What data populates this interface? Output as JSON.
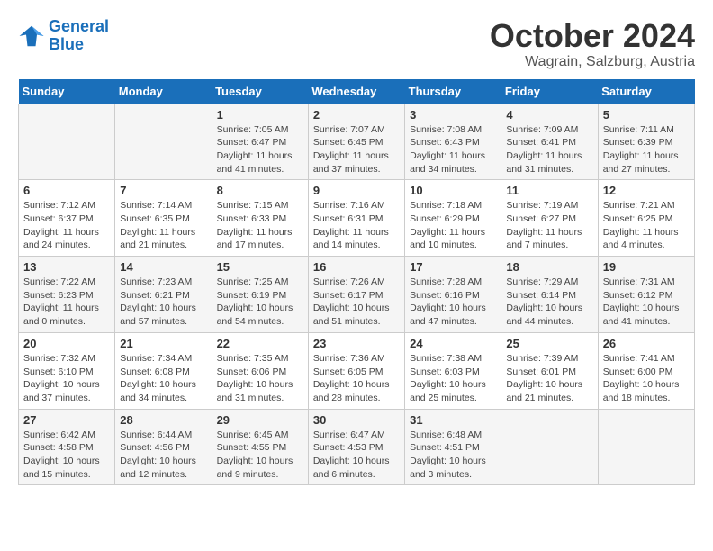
{
  "logo": {
    "line1": "General",
    "line2": "Blue"
  },
  "title": "October 2024",
  "location": "Wagrain, Salzburg, Austria",
  "days_of_week": [
    "Sunday",
    "Monday",
    "Tuesday",
    "Wednesday",
    "Thursday",
    "Friday",
    "Saturday"
  ],
  "weeks": [
    [
      {
        "day": "",
        "info": ""
      },
      {
        "day": "",
        "info": ""
      },
      {
        "day": "1",
        "info": "Sunrise: 7:05 AM\nSunset: 6:47 PM\nDaylight: 11 hours and 41 minutes."
      },
      {
        "day": "2",
        "info": "Sunrise: 7:07 AM\nSunset: 6:45 PM\nDaylight: 11 hours and 37 minutes."
      },
      {
        "day": "3",
        "info": "Sunrise: 7:08 AM\nSunset: 6:43 PM\nDaylight: 11 hours and 34 minutes."
      },
      {
        "day": "4",
        "info": "Sunrise: 7:09 AM\nSunset: 6:41 PM\nDaylight: 11 hours and 31 minutes."
      },
      {
        "day": "5",
        "info": "Sunrise: 7:11 AM\nSunset: 6:39 PM\nDaylight: 11 hours and 27 minutes."
      }
    ],
    [
      {
        "day": "6",
        "info": "Sunrise: 7:12 AM\nSunset: 6:37 PM\nDaylight: 11 hours and 24 minutes."
      },
      {
        "day": "7",
        "info": "Sunrise: 7:14 AM\nSunset: 6:35 PM\nDaylight: 11 hours and 21 minutes."
      },
      {
        "day": "8",
        "info": "Sunrise: 7:15 AM\nSunset: 6:33 PM\nDaylight: 11 hours and 17 minutes."
      },
      {
        "day": "9",
        "info": "Sunrise: 7:16 AM\nSunset: 6:31 PM\nDaylight: 11 hours and 14 minutes."
      },
      {
        "day": "10",
        "info": "Sunrise: 7:18 AM\nSunset: 6:29 PM\nDaylight: 11 hours and 10 minutes."
      },
      {
        "day": "11",
        "info": "Sunrise: 7:19 AM\nSunset: 6:27 PM\nDaylight: 11 hours and 7 minutes."
      },
      {
        "day": "12",
        "info": "Sunrise: 7:21 AM\nSunset: 6:25 PM\nDaylight: 11 hours and 4 minutes."
      }
    ],
    [
      {
        "day": "13",
        "info": "Sunrise: 7:22 AM\nSunset: 6:23 PM\nDaylight: 11 hours and 0 minutes."
      },
      {
        "day": "14",
        "info": "Sunrise: 7:23 AM\nSunset: 6:21 PM\nDaylight: 10 hours and 57 minutes."
      },
      {
        "day": "15",
        "info": "Sunrise: 7:25 AM\nSunset: 6:19 PM\nDaylight: 10 hours and 54 minutes."
      },
      {
        "day": "16",
        "info": "Sunrise: 7:26 AM\nSunset: 6:17 PM\nDaylight: 10 hours and 51 minutes."
      },
      {
        "day": "17",
        "info": "Sunrise: 7:28 AM\nSunset: 6:16 PM\nDaylight: 10 hours and 47 minutes."
      },
      {
        "day": "18",
        "info": "Sunrise: 7:29 AM\nSunset: 6:14 PM\nDaylight: 10 hours and 44 minutes."
      },
      {
        "day": "19",
        "info": "Sunrise: 7:31 AM\nSunset: 6:12 PM\nDaylight: 10 hours and 41 minutes."
      }
    ],
    [
      {
        "day": "20",
        "info": "Sunrise: 7:32 AM\nSunset: 6:10 PM\nDaylight: 10 hours and 37 minutes."
      },
      {
        "day": "21",
        "info": "Sunrise: 7:34 AM\nSunset: 6:08 PM\nDaylight: 10 hours and 34 minutes."
      },
      {
        "day": "22",
        "info": "Sunrise: 7:35 AM\nSunset: 6:06 PM\nDaylight: 10 hours and 31 minutes."
      },
      {
        "day": "23",
        "info": "Sunrise: 7:36 AM\nSunset: 6:05 PM\nDaylight: 10 hours and 28 minutes."
      },
      {
        "day": "24",
        "info": "Sunrise: 7:38 AM\nSunset: 6:03 PM\nDaylight: 10 hours and 25 minutes."
      },
      {
        "day": "25",
        "info": "Sunrise: 7:39 AM\nSunset: 6:01 PM\nDaylight: 10 hours and 21 minutes."
      },
      {
        "day": "26",
        "info": "Sunrise: 7:41 AM\nSunset: 6:00 PM\nDaylight: 10 hours and 18 minutes."
      }
    ],
    [
      {
        "day": "27",
        "info": "Sunrise: 6:42 AM\nSunset: 4:58 PM\nDaylight: 10 hours and 15 minutes."
      },
      {
        "day": "28",
        "info": "Sunrise: 6:44 AM\nSunset: 4:56 PM\nDaylight: 10 hours and 12 minutes."
      },
      {
        "day": "29",
        "info": "Sunrise: 6:45 AM\nSunset: 4:55 PM\nDaylight: 10 hours and 9 minutes."
      },
      {
        "day": "30",
        "info": "Sunrise: 6:47 AM\nSunset: 4:53 PM\nDaylight: 10 hours and 6 minutes."
      },
      {
        "day": "31",
        "info": "Sunrise: 6:48 AM\nSunset: 4:51 PM\nDaylight: 10 hours and 3 minutes."
      },
      {
        "day": "",
        "info": ""
      },
      {
        "day": "",
        "info": ""
      }
    ]
  ]
}
